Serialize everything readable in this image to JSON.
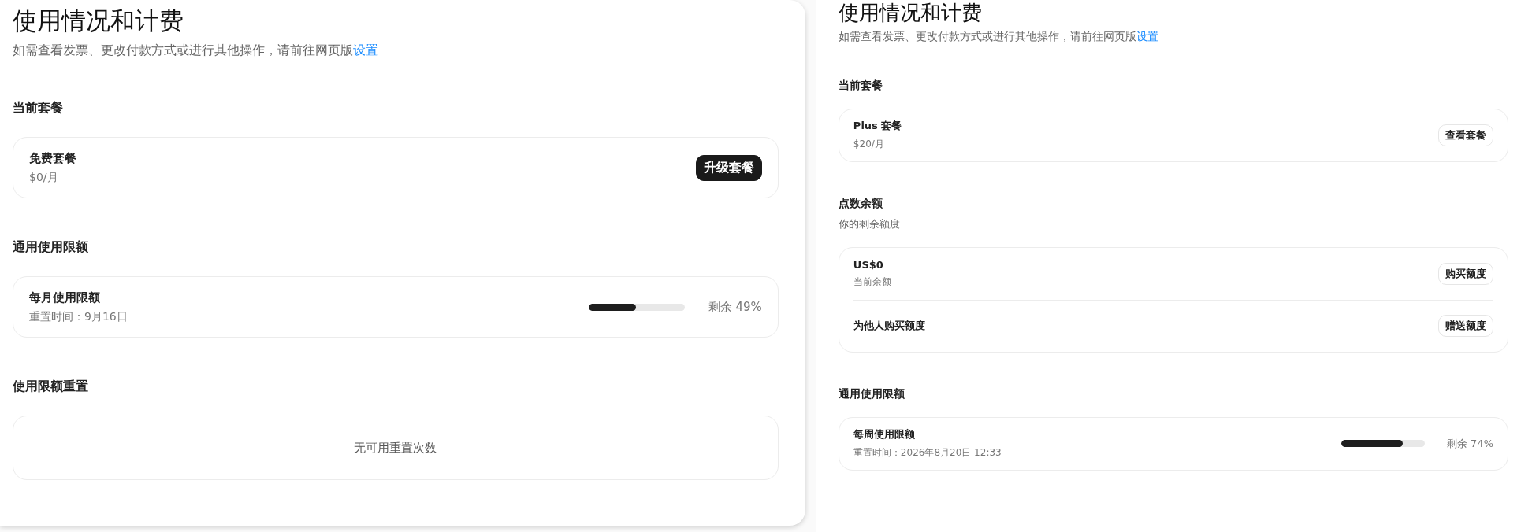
{
  "panels": [
    {
      "title": "使用情况和计费",
      "subtitle": "如需查看发票、更改付款方式或进行其他操作，请前往网页版",
      "link": "设置",
      "sections": [
        {
          "heading": "当前套餐",
          "rows": [
            {
              "kind": "action",
              "title": "免费套餐",
              "detail": "$0/月",
              "button": {
                "label": "升级套餐",
                "kind": "primary"
              }
            }
          ]
        },
        {
          "heading": "通用使用限额",
          "rows": [
            {
              "kind": "meter",
              "title": "每月使用限额",
              "detail": "重置时间：9月16日",
              "level": 0.49,
              "reading": "剩余 49%"
            }
          ]
        },
        {
          "heading": "使用限额重置",
          "rows": [
            {
              "kind": "notice",
              "text": "无可用重置次数"
            }
          ]
        }
      ]
    },
    {
      "title": "使用情况和计费",
      "subtitle": "如需查看发票、更改付款方式或进行其他操作，请前往网页版",
      "link": "设置",
      "sections": [
        {
          "heading": "当前套餐",
          "rows": [
            {
              "kind": "action",
              "title": "Plus 套餐",
              "detail": "$20/月",
              "button": {
                "label": "查看套餐",
                "kind": "outline"
              }
            }
          ]
        },
        {
          "heading": "点数余额",
          "description": "你的剩余额度",
          "rows": [
            {
              "kind": "action",
              "title": "US$0",
              "detail": "当前余额",
              "button": {
                "label": "购买额度",
                "kind": "outline"
              }
            },
            {
              "kind": "action",
              "title": "为他人购买额度",
              "button": {
                "label": "赠送额度",
                "kind": "outline"
              }
            }
          ]
        },
        {
          "heading": "通用使用限额",
          "rows": [
            {
              "kind": "meter",
              "title": "每周使用限额",
              "detail": "重置时间：2026年8月20日 12:33",
              "level": 0.74,
              "reading": "剩余 74%"
            }
          ]
        }
      ]
    }
  ]
}
